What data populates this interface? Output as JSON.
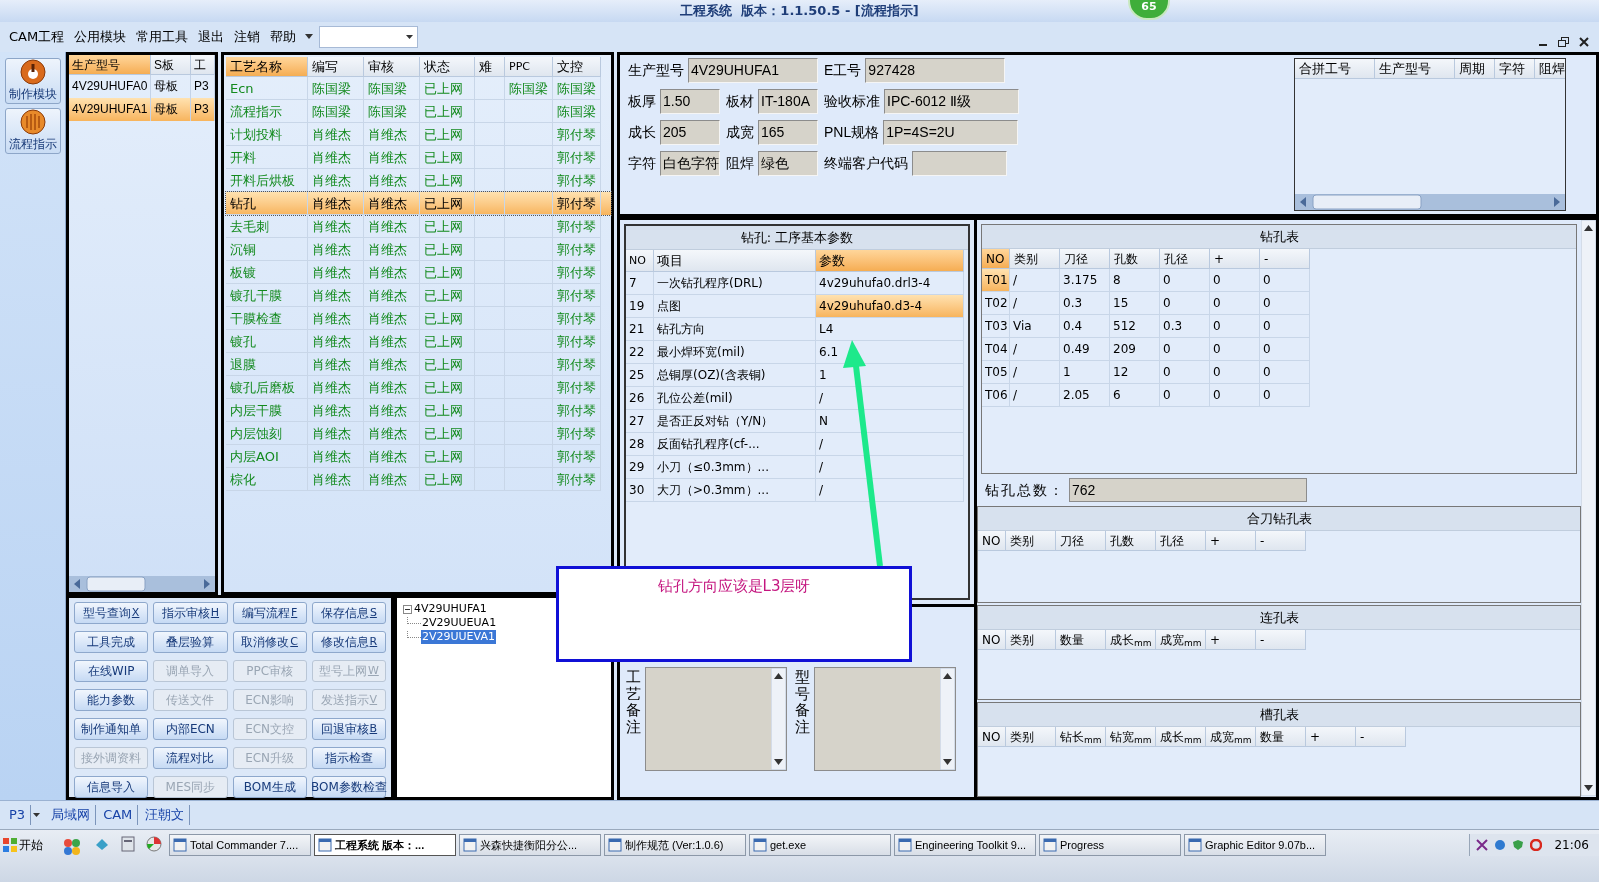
{
  "window": {
    "title": "工程系统  版本：1.1.50.5 - [流程指示]",
    "badge": "65"
  },
  "menu": [
    "CAM工程",
    "公用模块",
    "常用工具",
    "退出",
    "注销",
    "帮助"
  ],
  "sidebar": [
    {
      "label": "制作模块"
    },
    {
      "label": "流程指示"
    }
  ],
  "models": {
    "columns": [
      "生产型号",
      "S板",
      "工"
    ],
    "rows": [
      {
        "cells": [
          "4V29UHUFA0",
          "母板",
          "P3"
        ],
        "selected": false
      },
      {
        "cells": [
          "4V29UHUFA1",
          "母板",
          "P3"
        ],
        "selected": true
      }
    ]
  },
  "processes": {
    "columns": [
      "工艺名称",
      "编写",
      "审核",
      "状态",
      "难",
      "PPC",
      "文控"
    ],
    "rows": [
      {
        "name": "Ecn",
        "writer": "陈国梁",
        "reviewer": "陈国梁",
        "status": "已上网",
        "ppc": "陈国梁",
        "control": "陈国梁",
        "selected": false
      },
      {
        "name": "流程指示",
        "writer": "陈国梁",
        "reviewer": "陈国梁",
        "status": "已上网",
        "control": "陈国梁",
        "selected": false
      },
      {
        "name": "计划投料",
        "writer": "肖维杰",
        "reviewer": "肖维杰",
        "status": "已上网",
        "control": "郭付琴",
        "selected": false
      },
      {
        "name": "开料",
        "writer": "肖维杰",
        "reviewer": "肖维杰",
        "status": "已上网",
        "control": "郭付琴",
        "selected": false
      },
      {
        "name": "开料后烘板",
        "writer": "肖维杰",
        "reviewer": "肖维杰",
        "status": "已上网",
        "control": "郭付琴",
        "selected": false
      },
      {
        "name": "钻孔",
        "writer": "肖维杰",
        "reviewer": "肖维杰",
        "status": "已上网",
        "control": "郭付琴",
        "selected": true
      },
      {
        "name": "去毛刺",
        "writer": "肖维杰",
        "reviewer": "肖维杰",
        "status": "已上网",
        "control": "郭付琴",
        "selected": false
      },
      {
        "name": "沉铜",
        "writer": "肖维杰",
        "reviewer": "肖维杰",
        "status": "已上网",
        "control": "郭付琴",
        "selected": false
      },
      {
        "name": "板镀",
        "writer": "肖维杰",
        "reviewer": "肖维杰",
        "status": "已上网",
        "control": "郭付琴",
        "selected": false
      },
      {
        "name": "镀孔干膜",
        "writer": "肖维杰",
        "reviewer": "肖维杰",
        "status": "已上网",
        "control": "郭付琴",
        "selected": false
      },
      {
        "name": "干膜检查",
        "writer": "肖维杰",
        "reviewer": "肖维杰",
        "status": "已上网",
        "control": "郭付琴",
        "selected": false
      },
      {
        "name": "镀孔",
        "writer": "肖维杰",
        "reviewer": "肖维杰",
        "status": "已上网",
        "control": "郭付琴",
        "selected": false
      },
      {
        "name": "退膜",
        "writer": "肖维杰",
        "reviewer": "肖维杰",
        "status": "已上网",
        "control": "郭付琴",
        "selected": false
      },
      {
        "name": "镀孔后磨板",
        "writer": "肖维杰",
        "reviewer": "肖维杰",
        "status": "已上网",
        "control": "郭付琴",
        "selected": false
      },
      {
        "name": "内层干膜",
        "writer": "肖维杰",
        "reviewer": "肖维杰",
        "status": "已上网",
        "control": "郭付琴",
        "selected": false
      },
      {
        "name": "内层蚀刻",
        "writer": "肖维杰",
        "reviewer": "肖维杰",
        "status": "已上网",
        "control": "郭付琴",
        "selected": false
      },
      {
        "name": "内层AOI",
        "writer": "肖维杰",
        "reviewer": "肖维杰",
        "status": "已上网",
        "control": "郭付琴",
        "selected": false
      },
      {
        "name": "棕化",
        "writer": "肖维杰",
        "reviewer": "肖维杰",
        "status": "已上网",
        "control": "郭付琴",
        "selected": false
      }
    ]
  },
  "buttons": [
    {
      "label": "型号查询",
      "shortcut": "X",
      "disabled": false
    },
    {
      "label": "指示审核",
      "shortcut": "H",
      "disabled": false
    },
    {
      "label": "编写流程",
      "shortcut": "F",
      "disabled": false
    },
    {
      "label": "保存信息",
      "shortcut": "S",
      "disabled": false
    },
    {
      "label": "工具完成",
      "disabled": false
    },
    {
      "label": "叠层验算",
      "disabled": false
    },
    {
      "label": "取消修改",
      "shortcut": "C",
      "disabled": false
    },
    {
      "label": "修改信息",
      "shortcut": "R",
      "disabled": false
    },
    {
      "label": "在线WIP",
      "disabled": false
    },
    {
      "label": "调单导入",
      "disabled": true
    },
    {
      "label": "PPC审核",
      "disabled": true
    },
    {
      "label": "型号上网",
      "shortcut": "W",
      "disabled": true
    },
    {
      "label": "能力参数",
      "disabled": false
    },
    {
      "label": "传送文件",
      "disabled": true
    },
    {
      "label": "ECN影响",
      "disabled": true
    },
    {
      "label": "发送指示",
      "shortcut": "V",
      "disabled": true
    },
    {
      "label": "制作通知单",
      "disabled": false
    },
    {
      "label": "内部ECN",
      "disabled": false
    },
    {
      "label": "ECN文控",
      "disabled": true
    },
    {
      "label": "回退审核",
      "shortcut": "B",
      "disabled": false
    },
    {
      "label": "接外调资料",
      "disabled": true
    },
    {
      "label": "流程对比",
      "disabled": false
    },
    {
      "label": "ECN升级",
      "disabled": true
    },
    {
      "label": "指示检查",
      "disabled": false
    },
    {
      "label": "信息导入",
      "disabled": false
    },
    {
      "label": "MES同步",
      "disabled": true
    },
    {
      "label": "BOM生成",
      "disabled": false
    },
    {
      "label": "BOM参数检查",
      "disabled": false
    }
  ],
  "tree": {
    "label": "4V29UHUFA1",
    "expanded": true,
    "children": [
      {
        "label": "2V29UUEUA1",
        "selected": false
      },
      {
        "label": "2V29UUEVA1",
        "selected": true
      }
    ]
  },
  "info": {
    "fields": [
      {
        "label": "生产型号",
        "value": "4V29UHUFA1"
      },
      {
        "label": "E工号",
        "value": "927428"
      },
      {
        "label": "板厚",
        "value": "1.50"
      },
      {
        "label": "板材",
        "value": "IT-180A"
      },
      {
        "label": "验收标准",
        "value": "IPC-6012 Ⅱ级"
      },
      {
        "label": "成长",
        "value": "205"
      },
      {
        "label": "成宽",
        "value": "165"
      },
      {
        "label": "PNL规格",
        "value": "1P=4S=2U"
      },
      {
        "label": "字符",
        "value": "白色字符"
      },
      {
        "label": "阻焊",
        "value": "绿色"
      },
      {
        "label": "终端客户代码"
      }
    ]
  },
  "merge_table": {
    "columns": [
      "合拼工号",
      "生产型号",
      "周期",
      "字符",
      "阻焊"
    ]
  },
  "params": {
    "title": "钻孔: 工序基本参数",
    "columns": [
      "NO",
      "项目",
      "参数"
    ],
    "rows": [
      {
        "no": "7",
        "item": "一次钻孔程序(DRL)",
        "value": "4v29uhufa0.drl3-4",
        "selected": false
      },
      {
        "no": "19",
        "item": "点图",
        "value": "4v29uhufa0.d3-4",
        "selected": true
      },
      {
        "no": "21",
        "item": "钻孔方向",
        "value": "L4",
        "selected": false
      },
      {
        "no": "22",
        "item": "最小焊环宽(mil)",
        "value": "6.1",
        "selected": false
      },
      {
        "no": "25",
        "item": "总铜厚(OZ)(含表铜)",
        "value": "1",
        "selected": false
      },
      {
        "no": "26",
        "item": "孔位公差(mil)",
        "value": "/",
        "selected": false
      },
      {
        "no": "27",
        "item": "是否正反对钻（Y/N）",
        "value": "N",
        "selected": false
      },
      {
        "no": "28",
        "item": "反面钻孔程序(cf-...",
        "value": "/",
        "selected": false
      },
      {
        "no": "29",
        "item": "小刀（≤0.3mm）...",
        "value": "/",
        "selected": false
      },
      {
        "no": "30",
        "item": "大刀（>0.3mm）...",
        "value": "/",
        "selected": false
      }
    ]
  },
  "memos": [
    {
      "label": "工艺备注"
    },
    {
      "label": "型号备注"
    }
  ],
  "drill_table": {
    "title": "钻孔表",
    "columns": [
      "NO",
      "类别",
      "刀径",
      "孔数",
      "孔径",
      "+",
      "-"
    ],
    "rows": [
      {
        "cells": [
          "T01",
          "/",
          "3.175",
          "8",
          "0",
          "0",
          "0"
        ],
        "selected": true
      },
      {
        "cells": [
          "T02",
          "/",
          "0.3",
          "15",
          "0",
          "0",
          "0"
        ],
        "selected": false
      },
      {
        "cells": [
          "T03",
          "Via",
          "0.4",
          "512",
          "0.3",
          "0",
          "0"
        ],
        "selected": false
      },
      {
        "cells": [
          "T04",
          "/",
          "0.49",
          "209",
          "0",
          "0",
          "0"
        ],
        "selected": false
      },
      {
        "cells": [
          "T05",
          "/",
          "1",
          "12",
          "0",
          "0",
          "0"
        ],
        "selected": false
      },
      {
        "cells": [
          "T06",
          "/",
          "2.05",
          "6",
          "0",
          "0",
          "0"
        ],
        "selected": false
      }
    ]
  },
  "drill_total": {
    "label": "钻孔总数：",
    "value": "762"
  },
  "sub_tables": [
    {
      "title": "合刀钻孔表",
      "columns": [
        "NO",
        "类别",
        "刀径",
        "孔数",
        "孔径",
        "+",
        "-"
      ]
    },
    {
      "title": "连孔表",
      "columns": [
        "NO",
        "类别",
        "数量",
        "成长$_{mm}$",
        "成宽$_{mm}$",
        "+",
        "-"
      ]
    },
    {
      "title": "槽孔表",
      "columns": [
        "NO",
        "类别",
        "钻长$_{mm}$",
        "钻宽$_{mm}$",
        "成长$_{mm}$",
        "成宽$_{mm}$",
        "数量",
        "+",
        "-"
      ]
    }
  ],
  "annotation": {
    "text": "钻孔方向应该是L3层呀"
  },
  "status_bar": {
    "items": [
      "P3",
      "局域网",
      "CAM",
      "汪朝文"
    ]
  },
  "taskbar": {
    "start": "开始",
    "tasks": [
      {
        "label": "Total Commander 7....",
        "selected": false
      },
      {
        "label": "工程系统  版本：...",
        "selected": true
      },
      {
        "label": "兴森快捷衡阳分公...",
        "selected": false
      },
      {
        "label": "制作规范 (Ver:1.0.6)",
        "selected": false
      },
      {
        "label": "get.exe",
        "selected": false
      },
      {
        "label": "Engineering Toolkit 9...",
        "selected": false
      },
      {
        "label": "Progress",
        "selected": false
      },
      {
        "label": "Graphic Editor 9.07b...",
        "selected": false
      }
    ],
    "clock": "21:06"
  }
}
